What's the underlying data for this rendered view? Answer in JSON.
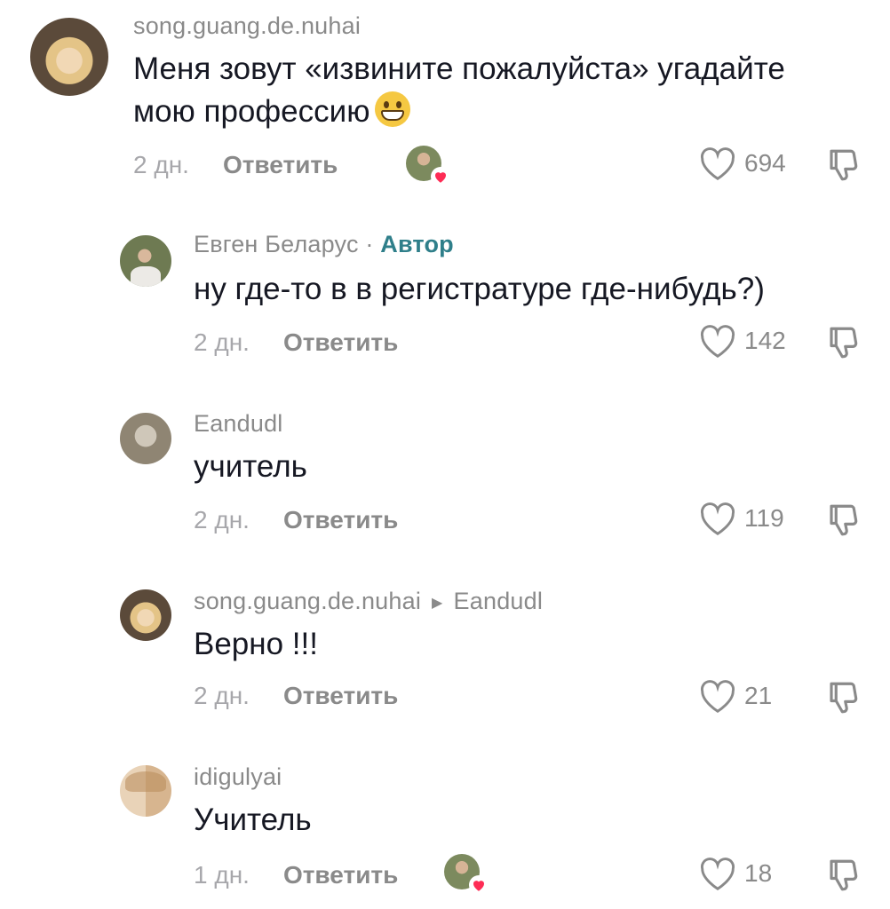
{
  "comments": [
    {
      "username": "song.guang.de.nuhai",
      "text": "Меня зовут «извините пожалуйста» угадайте",
      "text_line2": "мою профессию",
      "emoji": "grinning-face-emoji",
      "date": "2 дн.",
      "reply_label": "Ответить",
      "likes": "694",
      "liked_by_author": true
    },
    {
      "username": "Евген Беларус",
      "separator": "·",
      "author_badge": "Автор",
      "text": "ну где-то в в регистратуре где-нибудь?)",
      "date": "2 дн.",
      "reply_label": "Ответить",
      "likes": "142"
    },
    {
      "username": "Eandudl",
      "text": "учитель",
      "date": "2 дн.",
      "reply_label": "Ответить",
      "likes": "119"
    },
    {
      "username": "song.guang.de.nuhai",
      "reply_to": "Eandudl",
      "text": "Верно !!!",
      "date": "2 дн.",
      "reply_label": "Ответить",
      "likes": "21"
    },
    {
      "username": "idigulyai",
      "text": "Учитель",
      "date": "1 дн.",
      "reply_label": "Ответить",
      "likes": "18",
      "liked_by_author": true
    }
  ],
  "colors": {
    "username": "#8a8a8a",
    "text": "#161823",
    "author_badge": "#2f7f8a",
    "date": "#a7a7ab",
    "heart_red": "#fe2c55"
  },
  "icons": {
    "like": "heart-outline-icon",
    "dislike": "thumbs-down-outline-icon",
    "liked_by_creator": "creator-liked-badge-icon"
  }
}
